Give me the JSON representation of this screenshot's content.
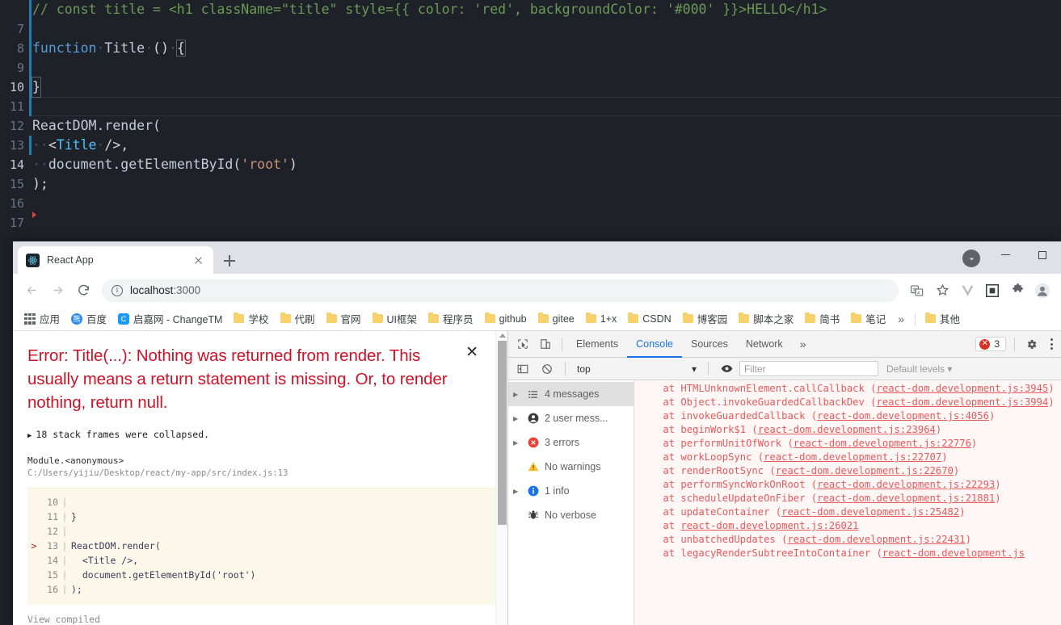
{
  "editor": {
    "lines": [
      {
        "num": "7",
        "type": "comment",
        "text": "// const title = <h1 className=\"title\" style={{ color: 'red', backgroundColor: '#000' }}>HELLO</h1>"
      },
      {
        "num": "8",
        "type": "blank",
        "text": ""
      },
      {
        "num": "9",
        "type": "fndecl",
        "text": "function Title () {"
      },
      {
        "num": "10",
        "type": "active",
        "text": ""
      },
      {
        "num": "11",
        "type": "brace",
        "text": "}"
      },
      {
        "num": "12",
        "type": "blank",
        "text": ""
      },
      {
        "num": "13",
        "type": "render",
        "text": "ReactDOM.render("
      },
      {
        "num": "14",
        "type": "jsx",
        "text": "  <Title />,"
      },
      {
        "num": "15",
        "type": "getel",
        "text": "  document.getElementById('root')"
      },
      {
        "num": "16",
        "type": "close",
        "text": ");"
      },
      {
        "num": "17",
        "type": "blank",
        "text": ""
      }
    ],
    "tokens": {
      "comment_text": "// const title = <h1 className=\"title\" style={{ color: 'red', backgroundColor: '#000' }}>HELLO</h1>",
      "kw_function": "function",
      "fn_name": "Title",
      "paren_empty": "()",
      "brace_open": "{",
      "brace_close": "}",
      "reactdom": "ReactDOM.render(",
      "jsx_indent": "··",
      "jsx_lt": "<",
      "jsx_title": "Title",
      "jsx_slash": "/>,",
      "getel_indent": "··",
      "getel_obj": "document.getElementById(",
      "getel_str": "'root'",
      "getel_end": ")",
      "close_stmt": ");"
    }
  },
  "browser": {
    "tab": {
      "title": "React App",
      "favicon": "react-logo-icon"
    },
    "newtab_label": "+",
    "window_controls": {
      "minimize": "minimize-icon",
      "maximize": "maximize-icon"
    },
    "toolbar": {
      "back": "back-arrow-icon",
      "forward": "forward-arrow-icon",
      "reload": "reload-icon",
      "site_info": "info-circle-icon",
      "url_host": "localhost",
      "url_port": ":3000",
      "url_full": "localhost:3000",
      "right_icons": [
        "translate-icon",
        "bookmark-star-icon",
        "vue-devtools-icon",
        "react-devtools-icon",
        "extensions-puzzle-icon",
        "profile-avatar-icon"
      ]
    },
    "bookmarks": [
      {
        "label": "应用",
        "icon": "apps-grid-icon"
      },
      {
        "label": "百度",
        "icon": "baidu-icon"
      },
      {
        "label": "启嘉网 - ChangeTM",
        "icon": "changetm-icon"
      },
      {
        "label": "学校",
        "icon": "folder-icon"
      },
      {
        "label": "代刷",
        "icon": "folder-icon"
      },
      {
        "label": "官网",
        "icon": "folder-icon"
      },
      {
        "label": "UI框架",
        "icon": "folder-icon"
      },
      {
        "label": "程序员",
        "icon": "folder-icon"
      },
      {
        "label": "github",
        "icon": "folder-icon"
      },
      {
        "label": "gitee",
        "icon": "folder-icon"
      },
      {
        "label": "1+x",
        "icon": "folder-icon"
      },
      {
        "label": "CSDN",
        "icon": "folder-icon"
      },
      {
        "label": "博客园",
        "icon": "folder-icon"
      },
      {
        "label": "脚本之家",
        "icon": "folder-icon"
      },
      {
        "label": "简书",
        "icon": "folder-icon"
      },
      {
        "label": "笔记",
        "icon": "folder-icon"
      },
      {
        "label": "其他",
        "icon": "folder-icon"
      }
    ],
    "bookmarks_overflow": "»"
  },
  "error_overlay": {
    "headline": "Error: Title(...): Nothing was returned from render. This usually means a return statement is missing. Or, to render nothing, return null.",
    "close_label": "✕",
    "collapsed_frames": "18 stack frames were collapsed.",
    "module_name": "Module.<anonymous>",
    "module_path": "C:/Users/yijiu/Desktop/react/my-app/src/index.js:13",
    "code_frame": [
      {
        "arrow": "",
        "ln": "10",
        "src": ""
      },
      {
        "arrow": "",
        "ln": "11",
        "src": "}"
      },
      {
        "arrow": "",
        "ln": "12",
        "src": ""
      },
      {
        "arrow": ">",
        "ln": "13",
        "src": "ReactDOM.render("
      },
      {
        "arrow": "",
        "ln": "14",
        "src": "  <Title />,"
      },
      {
        "arrow": "",
        "ln": "15",
        "src": "  document.getElementById('root')"
      },
      {
        "arrow": "",
        "ln": "16",
        "src": ");"
      }
    ],
    "view_compiled": "View compiled"
  },
  "devtools": {
    "inspect_icon": "inspect-element-icon",
    "device_icon": "device-toolbar-icon",
    "tabs": [
      {
        "label": "Elements",
        "active": false
      },
      {
        "label": "Console",
        "active": true
      },
      {
        "label": "Sources",
        "active": false
      },
      {
        "label": "Network",
        "active": false
      }
    ],
    "more_tabs": "»",
    "error_count": "3",
    "error_icon": "error-circle-icon",
    "settings_icon": "gear-icon",
    "menu_icon": "kebab-menu-icon",
    "filterbar": {
      "sidebar_toggle_icon": "show-console-sidebar-icon",
      "clear_icon": "clear-console-icon",
      "context": "top",
      "context_caret": "▾",
      "eye_icon": "live-expression-eye-icon",
      "filter_placeholder": "Filter",
      "levels": "Default levels",
      "levels_caret": "▾"
    },
    "sidebar": [
      {
        "label": "4 messages",
        "icon": "list-icon",
        "icon_glyph": "☰",
        "expandable": true,
        "selected": true
      },
      {
        "label": "2 user mess...",
        "icon": "user-icon",
        "icon_glyph": "",
        "expandable": true,
        "selected": false
      },
      {
        "label": "3 errors",
        "icon": "error-icon",
        "icon_glyph": "✕",
        "expandable": true,
        "selected": false
      },
      {
        "label": "No warnings",
        "icon": "warning-icon",
        "icon_glyph": "!",
        "expandable": false,
        "selected": false
      },
      {
        "label": "1 info",
        "icon": "info-icon",
        "icon_glyph": "i",
        "expandable": true,
        "selected": false
      },
      {
        "label": "No verbose",
        "icon": "bug-icon",
        "icon_glyph": "✹",
        "expandable": false,
        "selected": false
      }
    ],
    "console_stack": [
      {
        "prefix": "    at HTMLUnknownElement.callCallback (",
        "link": "react-dom.development.js:3945",
        "suffix": ")"
      },
      {
        "prefix": "    at Object.invokeGuardedCallbackDev (",
        "link": "react-dom.development.js:3994",
        "suffix": ")"
      },
      {
        "prefix": "    at invokeGuardedCallback (",
        "link": "react-dom.development.js:4056",
        "suffix": ")"
      },
      {
        "prefix": "    at beginWork$1 (",
        "link": "react-dom.development.js:23964",
        "suffix": ")"
      },
      {
        "prefix": "    at performUnitOfWork (",
        "link": "react-dom.development.js:22776",
        "suffix": ")"
      },
      {
        "prefix": "    at workLoopSync (",
        "link": "react-dom.development.js:22707",
        "suffix": ")"
      },
      {
        "prefix": "    at renderRootSync (",
        "link": "react-dom.development.js:22670",
        "suffix": ")"
      },
      {
        "prefix": "    at performSyncWorkOnRoot (",
        "link": "react-dom.development.js:22293",
        "suffix": ")"
      },
      {
        "prefix": "    at scheduleUpdateOnFiber (",
        "link": "react-dom.development.js:21881",
        "suffix": ")"
      },
      {
        "prefix": "    at updateContainer (",
        "link": "react-dom.development.js:25482",
        "suffix": ")"
      },
      {
        "prefix": "    at ",
        "link": "react-dom.development.js:26021",
        "suffix": ""
      },
      {
        "prefix": "    at unbatchedUpdates (",
        "link": "react-dom.development.js:22431",
        "suffix": ")"
      },
      {
        "prefix": "    at legacyRenderSubtreeIntoContainer (",
        "link": "react-dom.development.js",
        "suffix": ""
      }
    ]
  },
  "colors": {
    "accent_blue": "#1a73e8",
    "error_red": "#d93025",
    "overlay_error": "#ce1126",
    "console_bg": "#fff6f6",
    "console_text": "#e8595b",
    "editor_bg": "#1e2228",
    "folder_yellow": "#f7d16b"
  }
}
